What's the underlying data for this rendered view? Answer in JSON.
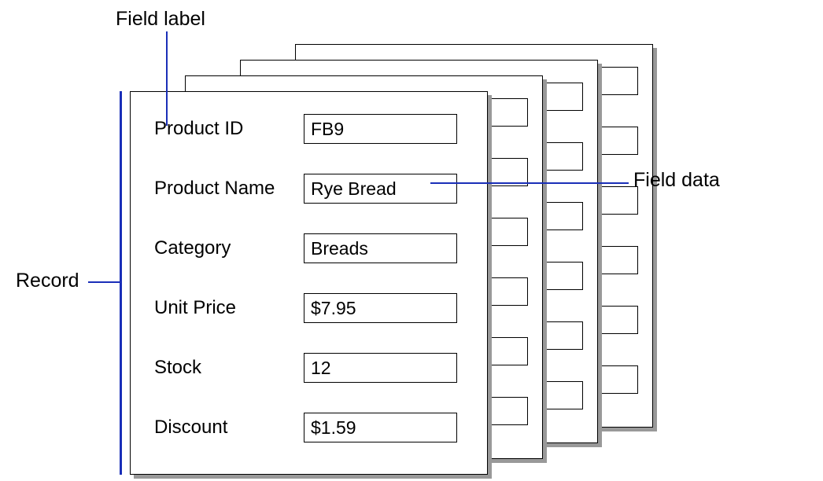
{
  "annotations": {
    "field_label": "Field label",
    "field_data": "Field data",
    "record": "Record"
  },
  "fields": [
    {
      "label": "Product ID",
      "value": "FB9"
    },
    {
      "label": "Product Name",
      "value": "Rye Bread"
    },
    {
      "label": "Category",
      "value": "Breads"
    },
    {
      "label": "Unit Price",
      "value": "$7.95"
    },
    {
      "label": "Stock",
      "value": "12"
    },
    {
      "label": "Discount",
      "value": "$1.59"
    }
  ]
}
